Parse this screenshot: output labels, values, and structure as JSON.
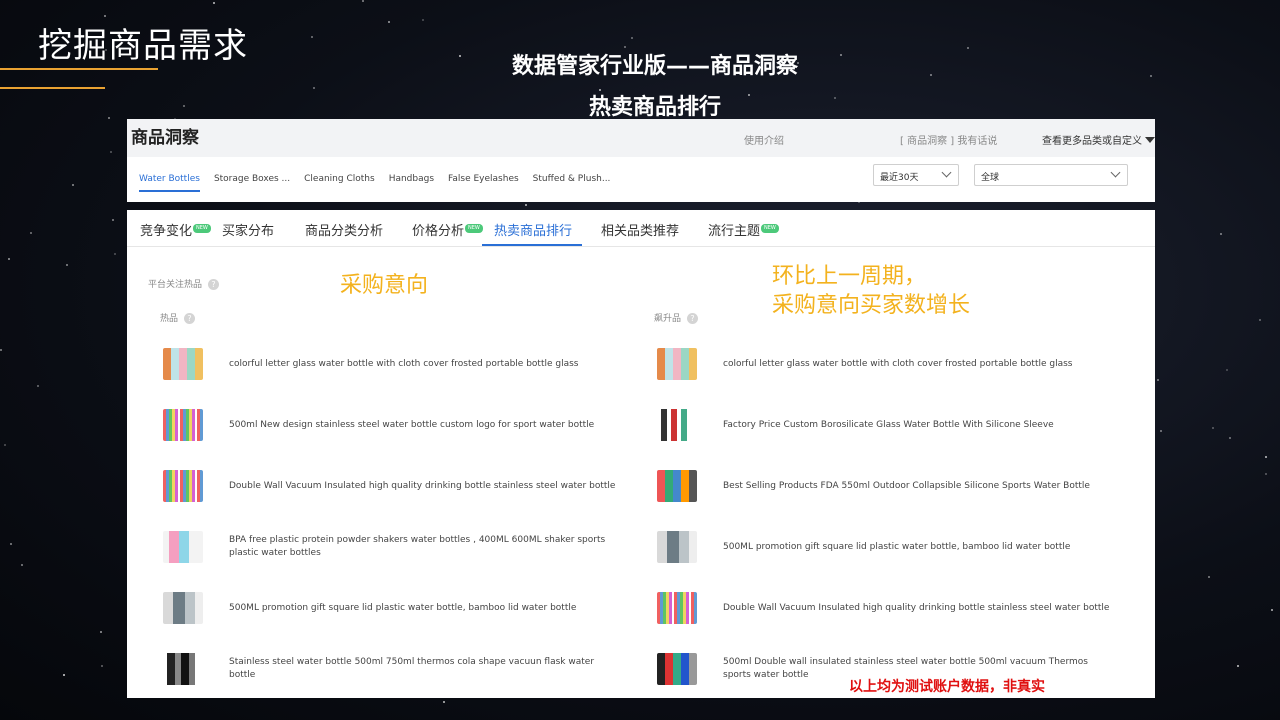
{
  "slide": {
    "title": "挖掘商品需求",
    "subtitle_line1": "数据管家行业版——商品洞察",
    "subtitle_line2": "热卖商品排行"
  },
  "header": {
    "title": "商品洞察",
    "intro_link": "使用介绍",
    "links": "[ 商品洞察 ] 我有话说",
    "more_categories": "查看更多品类或自定义"
  },
  "category_tabs": [
    {
      "label": "Water Bottles",
      "active": true
    },
    {
      "label": "Storage Boxes ...",
      "active": false
    },
    {
      "label": "Cleaning Cloths",
      "active": false
    },
    {
      "label": "Handbags",
      "active": false
    },
    {
      "label": "False Eyelashes",
      "active": false
    },
    {
      "label": "Stuffed & Plush...",
      "active": false
    }
  ],
  "filters": {
    "period": "最近30天",
    "region": "全球"
  },
  "main_tabs": [
    {
      "label": "竞争变化",
      "badge": "NEW"
    },
    {
      "label": "买家分布",
      "badge": ""
    },
    {
      "label": "商品分类分析",
      "badge": ""
    },
    {
      "label": "价格分析",
      "badge": "NEW"
    },
    {
      "label": "热卖商品排行",
      "badge": "",
      "active": true
    },
    {
      "label": "相关品类推荐",
      "badge": ""
    },
    {
      "label": "流行主题",
      "badge": "NEW"
    }
  ],
  "section": {
    "platform_label": "平台关注热品",
    "hot_label": "热品",
    "rising_label": "飙升品",
    "help_glyph": "?"
  },
  "annotations": {
    "left": "采购意向",
    "right_line1": "环比上一周期，",
    "right_line2": "采购意向买家数增长"
  },
  "hot_products": [
    {
      "name": "colorful letter glass water bottle with cloth cover frosted portable bottle glass",
      "thumb": "glass"
    },
    {
      "name": "500ml New design stainless steel water bottle custom logo for sport water bottle",
      "thumb": "multi"
    },
    {
      "name": "Double Wall Vacuum Insulated high quality drinking bottle stainless steel water bottle",
      "thumb": "multi"
    },
    {
      "name": "BPA free plastic protein powder shakers water bottles , 400ML 600ML shaker sports plastic water bottles",
      "thumb": "shaker"
    },
    {
      "name": "500ML promotion gift square lid plastic water bottle, bamboo lid water bottle",
      "thumb": "square"
    },
    {
      "name": "Stainless steel water bottle 500ml 750ml thermos cola shape vacuun flask water bottle",
      "thumb": "steel"
    }
  ],
  "rising_products": [
    {
      "name": "colorful letter glass water bottle with cloth cover frosted portable bottle glass",
      "thumb": "glass"
    },
    {
      "name": "Factory Price Custom Borosilicate Glass Water Bottle With Silicone Sleeve",
      "thumb": "sleeve"
    },
    {
      "name": "Best Selling Products FDA 550ml Outdoor Collapsible Silicone Sports Water Bottle",
      "thumb": "collapse"
    },
    {
      "name": "500ML promotion gift square lid plastic water bottle, bamboo lid water bottle",
      "thumb": "square"
    },
    {
      "name": "Double Wall Vacuum Insulated high quality drinking bottle stainless steel water bottle",
      "thumb": "multi"
    },
    {
      "name": "500ml Double wall insulated stainless steel water bottle 500ml vacuum Thermos sports water bottle",
      "thumb": "thermo"
    }
  ],
  "disclaimer": "以上均为测试账户数据，非真实",
  "colors": {
    "accent_orange": "#e9a232",
    "annotation_yellow": "#f3b21e",
    "active_blue": "#2a6fd6",
    "new_badge_green": "#4cc97a",
    "disclaimer_red": "#e01010"
  }
}
